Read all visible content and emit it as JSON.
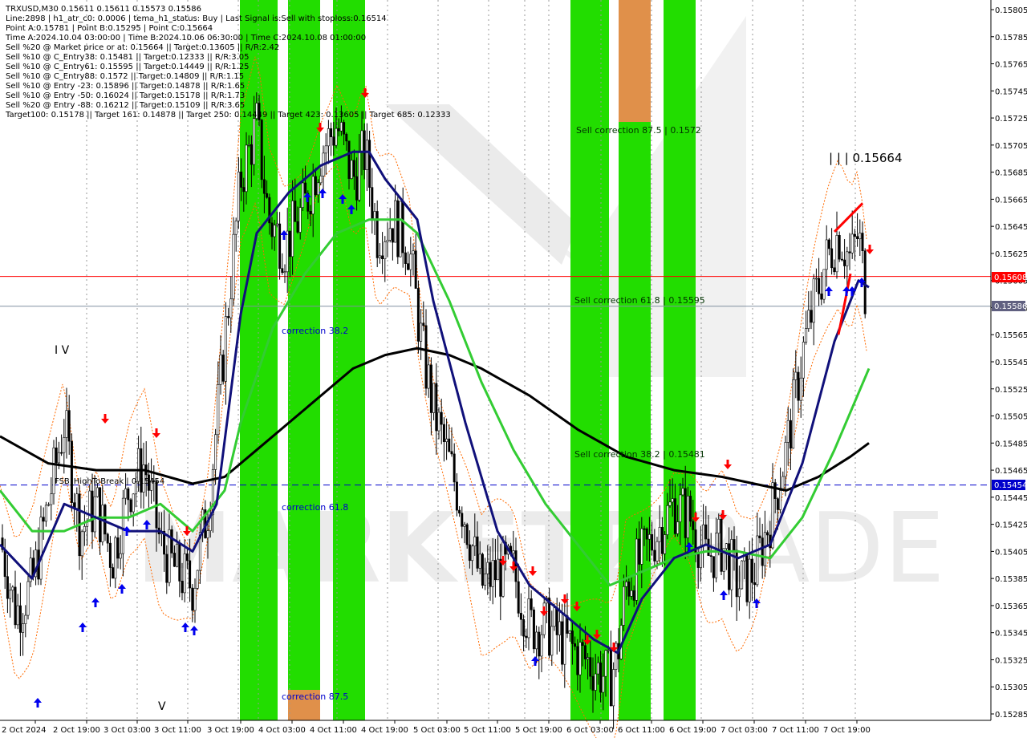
{
  "info_lines": [
    "TRXUSD,M30  0.15611 0.15611 0.15573 0.15586",
    "Line:2898 | h1_atr_c0: 0.0006 | tema_h1_status: Buy | Last Signal is:Sell with stoploss:0.16514",
    "Point A:0.15781 | Point B:0.15295 | Point C:0.15664",
    "Time A:2024.10.04 03:00:00 | Time B:2024.10.06 06:30:00 | Time C:2024.10.08 01:00:00",
    "Sell %20 @ Market price or at: 0.15664 || Target:0.13605 || R/R:2.42",
    "Sell %10 @ C_Entry38: 0.15481 || Target:0.12333 || R/R:3.05",
    "Sell %10 @ C_Entry61: 0.15595 || Target:0.14449 || R/R:1.25",
    "Sell %10 @ C_Entry88: 0.1572 || Target:0.14809 || R/R:1.15",
    "Sell %10 @ Entry -23: 0.15896 || Target:0.14878 || R/R:1.65",
    "Sell %10 @ Entry -50: 0.16024 || Target:0.15178 || R/R:1.73",
    "Sell %20 @ Entry -88: 0.16212 || Target:0.15109 || R/R:3.65",
    "Target100: 0.15178 || Target 161: 0.14878 || Target 250: 0.14449 || Target 423: 0.13605 || Target 685: 0.12333"
  ],
  "annotations": {
    "sell_corr_875": "Sell correction 87.5 | 0.1572",
    "sell_corr_618": "Sell correction 61.8 | 0.15595",
    "sell_corr_382": "Sell correction 38.2 | 0.15481",
    "corr_382": "correction 38.2",
    "corr_618": "correction 61.8",
    "corr_875": "correction 87.5",
    "point_c": "| | | 0.15664",
    "fsb": "FSB_HighToBreak | 0.15454",
    "wave_iv": "I V",
    "wave_v": "V"
  },
  "colors": {
    "green_zone": "#22dd00",
    "orange_zone": "#e0904a",
    "red_line": "#ff0000",
    "blue_dash": "#0000cc",
    "navy_ma": "#10107a",
    "green_ma": "#33cc33",
    "black_ma": "#000000",
    "bull": "#ffffff",
    "bear": "#000000"
  },
  "chart_data": {
    "type": "candlestick",
    "symbol": "TRXUSD",
    "timeframe": "M30",
    "ylim": [
      0.15285,
      0.15805
    ],
    "price_ticks": [
      "0.15805",
      "0.15785",
      "0.15765",
      "0.15745",
      "0.15725",
      "0.15705",
      "0.15685",
      "0.15665",
      "0.15645",
      "0.15625",
      "0.15605",
      "0.15585",
      "0.15565",
      "0.15545",
      "0.15525",
      "0.15505",
      "0.15485",
      "0.15465",
      "0.15445",
      "0.15425",
      "0.15405",
      "0.15385",
      "0.15365",
      "0.15345",
      "0.15325",
      "0.15305",
      "0.15285"
    ],
    "time_labels": [
      "2 Oct 2024",
      "2 Oct 19:00",
      "3 Oct 03:00",
      "3 Oct 11:00",
      "3 Oct 19:00",
      "4 Oct 03:00",
      "4 Oct 11:00",
      "4 Oct 19:00",
      "5 Oct 03:00",
      "5 Oct 11:00",
      "5 Oct 19:00",
      "6 Oct 03:00",
      "6 Oct 11:00",
      "6 Oct 19:00",
      "7 Oct 03:00",
      "7 Oct 11:00",
      "7 Oct 19:00"
    ],
    "ohlc_last": {
      "open": 0.15611,
      "high": 0.15611,
      "low": 0.15573,
      "close": 0.15586
    },
    "current_price": 0.15586,
    "red_level": 0.15608,
    "fsb_high_to_break": 0.15454,
    "point_c": 0.15664,
    "price_path": [
      [
        0,
        0.15415
      ],
      [
        20,
        0.1536
      ],
      [
        40,
        0.1538
      ],
      [
        60,
        0.1544
      ],
      [
        80,
        0.155
      ],
      [
        100,
        0.1542
      ],
      [
        120,
        0.1544
      ],
      [
        140,
        0.154
      ],
      [
        160,
        0.1545
      ],
      [
        180,
        0.1547
      ],
      [
        200,
        0.1541
      ],
      [
        220,
        0.1539
      ],
      [
        240,
        0.1538
      ],
      [
        260,
        0.1544
      ],
      [
        280,
        0.1556
      ],
      [
        300,
        0.1568
      ],
      [
        320,
        0.1572
      ],
      [
        335,
        0.1565
      ],
      [
        355,
        0.1563
      ],
      [
        380,
        0.1566
      ],
      [
        400,
        0.157
      ],
      [
        420,
        0.1572
      ],
      [
        440,
        0.1568
      ],
      [
        455,
        0.157
      ],
      [
        470,
        0.1564
      ],
      [
        490,
        0.1565
      ],
      [
        510,
        0.1563
      ],
      [
        525,
        0.1556
      ],
      [
        540,
        0.1551
      ],
      [
        560,
        0.1547
      ],
      [
        580,
        0.1543
      ],
      [
        600,
        0.1538
      ],
      [
        620,
        0.1539
      ],
      [
        640,
        0.1539
      ],
      [
        660,
        0.1535
      ],
      [
        680,
        0.1535
      ],
      [
        700,
        0.1534
      ],
      [
        720,
        0.1533
      ],
      [
        740,
        0.1532
      ],
      [
        760,
        0.1531
      ],
      [
        770,
        0.1533
      ],
      [
        780,
        0.1538
      ],
      [
        800,
        0.154
      ],
      [
        820,
        0.1542
      ],
      [
        840,
        0.1544
      ],
      [
        860,
        0.1543
      ],
      [
        880,
        0.154
      ],
      [
        900,
        0.1541
      ],
      [
        920,
        0.1538
      ],
      [
        940,
        0.1539
      ],
      [
        960,
        0.1543
      ],
      [
        980,
        0.1548
      ],
      [
        1000,
        0.1555
      ],
      [
        1015,
        0.1559
      ],
      [
        1030,
        0.1562
      ],
      [
        1045,
        0.1564
      ],
      [
        1060,
        0.1562
      ],
      [
        1070,
        0.1564
      ],
      [
        1078,
        0.156
      ],
      [
        1083,
        0.15586
      ]
    ],
    "ma_navy": [
      [
        0,
        0.1541
      ],
      [
        40,
        0.15385
      ],
      [
        80,
        0.1544
      ],
      [
        120,
        0.1543
      ],
      [
        160,
        0.1542
      ],
      [
        200,
        0.1542
      ],
      [
        240,
        0.15405
      ],
      [
        270,
        0.1544
      ],
      [
        300,
        0.1558
      ],
      [
        320,
        0.1564
      ],
      [
        360,
        0.1567
      ],
      [
        400,
        0.1569
      ],
      [
        440,
        0.157
      ],
      [
        460,
        0.157
      ],
      [
        480,
        0.1568
      ],
      [
        520,
        0.1565
      ],
      [
        540,
        0.1559
      ],
      [
        580,
        0.155
      ],
      [
        620,
        0.1542
      ],
      [
        660,
        0.1538
      ],
      [
        700,
        0.1536
      ],
      [
        740,
        0.1534
      ],
      [
        770,
        0.1533
      ],
      [
        800,
        0.1537
      ],
      [
        840,
        0.154
      ],
      [
        880,
        0.1541
      ],
      [
        920,
        0.154
      ],
      [
        960,
        0.1541
      ],
      [
        1000,
        0.1547
      ],
      [
        1040,
        0.1556
      ],
      [
        1070,
        0.15605
      ],
      [
        1083,
        0.156
      ]
    ],
    "ma_green": [
      [
        0,
        0.1545
      ],
      [
        40,
        0.1542
      ],
      [
        80,
        0.1542
      ],
      [
        120,
        0.1543
      ],
      [
        160,
        0.1543
      ],
      [
        200,
        0.1544
      ],
      [
        240,
        0.1542
      ],
      [
        280,
        0.1545
      ],
      [
        300,
        0.155
      ],
      [
        340,
        0.1557
      ],
      [
        380,
        0.1561
      ],
      [
        420,
        0.1564
      ],
      [
        460,
        0.1565
      ],
      [
        500,
        0.1565
      ],
      [
        520,
        0.1564
      ],
      [
        560,
        0.1559
      ],
      [
        600,
        0.1553
      ],
      [
        640,
        0.1548
      ],
      [
        680,
        0.1544
      ],
      [
        720,
        0.1541
      ],
      [
        760,
        0.1538
      ],
      [
        800,
        0.1539
      ],
      [
        840,
        0.154
      ],
      [
        880,
        0.15405
      ],
      [
        920,
        0.15405
      ],
      [
        960,
        0.154
      ],
      [
        1000,
        0.1543
      ],
      [
        1040,
        0.1548
      ],
      [
        1083,
        0.1554
      ]
    ],
    "ma_black": [
      [
        0,
        0.1549
      ],
      [
        60,
        0.1547
      ],
      [
        120,
        0.15465
      ],
      [
        180,
        0.15465
      ],
      [
        240,
        0.15455
      ],
      [
        280,
        0.1546
      ],
      [
        320,
        0.1548
      ],
      [
        380,
        0.1551
      ],
      [
        440,
        0.1554
      ],
      [
        480,
        0.1555
      ],
      [
        520,
        0.15555
      ],
      [
        560,
        0.1555
      ],
      [
        600,
        0.1554
      ],
      [
        660,
        0.1552
      ],
      [
        720,
        0.15495
      ],
      [
        780,
        0.15475
      ],
      [
        840,
        0.15465
      ],
      [
        900,
        0.1546
      ],
      [
        940,
        0.15455
      ],
      [
        980,
        0.1545
      ],
      [
        1020,
        0.1546
      ],
      [
        1060,
        0.15475
      ],
      [
        1083,
        0.15485
      ]
    ]
  }
}
